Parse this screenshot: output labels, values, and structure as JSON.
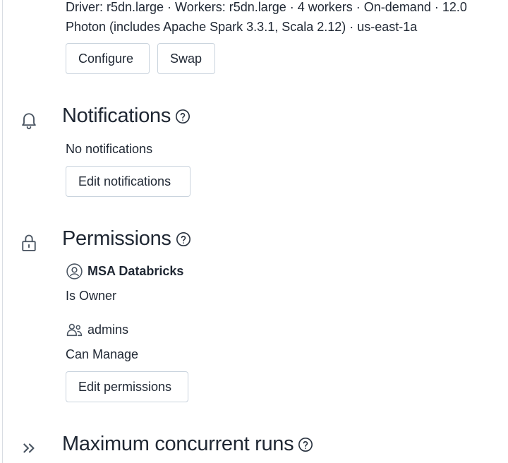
{
  "cluster": {
    "summary_line1": "Driver: r5dn.large · Workers: r5dn.large · 4 workers · On-demand · 12.0",
    "summary_line2": "Photon (includes Apache Spark 3.3.1, Scala 2.12) · us-east-1a",
    "configure_label": "Configure",
    "swap_label": "Swap"
  },
  "notifications": {
    "title": "Notifications",
    "icon": "bell-icon",
    "status": "No notifications",
    "edit_label": "Edit notifications"
  },
  "permissions": {
    "title": "Permissions",
    "icon": "lock-icon",
    "entries": [
      {
        "name": "MSA Databricks",
        "role": "Is Owner",
        "icon": "user-circle-icon"
      },
      {
        "name": "admins",
        "role": "Can Manage",
        "icon": "group-icon"
      }
    ],
    "edit_label": "Edit permissions"
  },
  "concurrent_runs": {
    "title": "Maximum concurrent runs",
    "icon": "double-chevron-right-icon"
  }
}
